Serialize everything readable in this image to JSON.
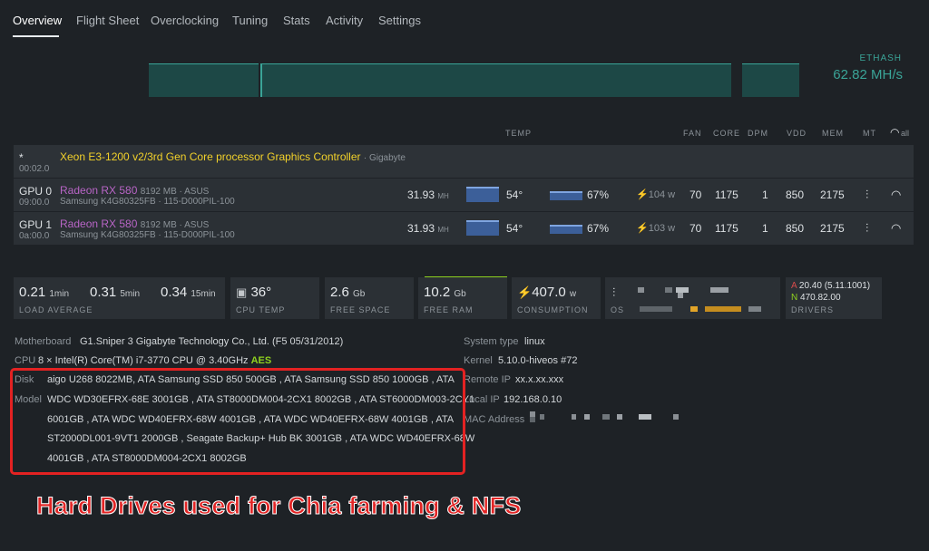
{
  "tabs": [
    "Overview",
    "Flight Sheet",
    "Overclocking",
    "Tuning",
    "Stats",
    "Activity",
    "Settings"
  ],
  "algo": {
    "name": "ETHASH",
    "hashrate": "62.82 MH/s"
  },
  "columns": {
    "temp": "TEMP",
    "fan": "FAN",
    "core": "CORE",
    "dpm": "DPM",
    "vdd": "VDD",
    "mem": "MEM",
    "mt": "MT",
    "all": "all"
  },
  "igpu": {
    "id": "*",
    "bus": "00:02.0",
    "name": "Xeon E3-1200 v2/3rd Gen Core processor Graphics Controller",
    "brand": "· Gigabyte"
  },
  "gpus": [
    {
      "id": "GPU 0",
      "bus": "09:00.0",
      "name": "Radeon RX 580",
      "mem": "8192 MB · ASUS",
      "sub": "Samsung K4G80325FB · 115-D000PIL-100",
      "hash": "31.93",
      "hash_unit": "MH",
      "temp": "54°",
      "fan_pct": "67%",
      "power": "104",
      "power_unit": "w",
      "fan": "70",
      "core": "1175",
      "dpm": "1",
      "vdd": "850",
      "memclk": "2175"
    },
    {
      "id": "GPU 1",
      "bus": "0a:00.0",
      "name": "Radeon RX 580",
      "mem": "8192 MB · ASUS",
      "sub": "Samsung K4G80325FB · 115-D000PIL-100",
      "hash": "31.93",
      "hash_unit": "MH",
      "temp": "54°",
      "fan_pct": "67%",
      "power": "103",
      "power_unit": "w",
      "fan": "70",
      "core": "1175",
      "dpm": "1",
      "vdd": "850",
      "memclk": "2175"
    }
  ],
  "summary": {
    "load": {
      "v1": "0.21",
      "u1": "1min",
      "v2": "0.31",
      "u2": "5min",
      "v3": "0.34",
      "u3": "15min",
      "title": "LOAD AVERAGE"
    },
    "cpu_temp": {
      "value": "36°",
      "title": "CPU TEMP"
    },
    "free_space": {
      "value": "2.6",
      "unit": "Gb",
      "title": "FREE SPACE"
    },
    "free_ram": {
      "value": "10.2",
      "unit": "Gb",
      "title": "FREE RAM"
    },
    "consumption": {
      "value": "407.0",
      "unit": "w",
      "title": "CONSUMPTION"
    },
    "os": {
      "title": "OS"
    },
    "drivers": {
      "a_label": "A",
      "a_value": "20.40 (5.11.1001)",
      "n_label": "N",
      "n_value": "470.82.00",
      "title": "DRIVERS"
    }
  },
  "info": {
    "motherboard_label": "Motherboard",
    "motherboard": "G1.Sniper 3 Gigabyte Technology Co., Ltd. (F5 05/31/2012)",
    "cpu_label": "CPU",
    "cpu": "8 × Intel(R) Core(TM) i7-3770 CPU @ 3.40GHz",
    "cpu_flag": "AES",
    "disk_label": "Disk",
    "model_label": "Model",
    "disk_lines": [
      "aigo U268 8022MB, ATA Samsung SSD 850 500GB , ATA Samsung SSD 850 1000GB , ATA",
      "WDC WD30EFRX-68E 3001GB , ATA ST8000DM004-2CX1 8002GB , ATA ST6000DM003-2CY1",
      "6001GB , ATA WDC WD40EFRX-68W 4001GB , ATA WDC WD40EFRX-68W 4001GB , ATA",
      "ST2000DL001-9VT1 2000GB , Seagate Backup+ Hub BK 3001GB , ATA WDC WD40EFRX-68W",
      "4001GB , ATA ST8000DM004-2CX1 8002GB"
    ],
    "system_type_label": "System type",
    "system_type": "linux",
    "kernel_label": "Kernel",
    "kernel": "5.10.0-hiveos #72",
    "remote_ip_label": "Remote IP",
    "remote_ip": "xx.x.xx.xxx",
    "local_ip_label": "Local IP",
    "local_ip": "192.168.0.10",
    "mac_label": "MAC Address"
  },
  "caption": "Hard Drives used for Chia farming & NFS"
}
